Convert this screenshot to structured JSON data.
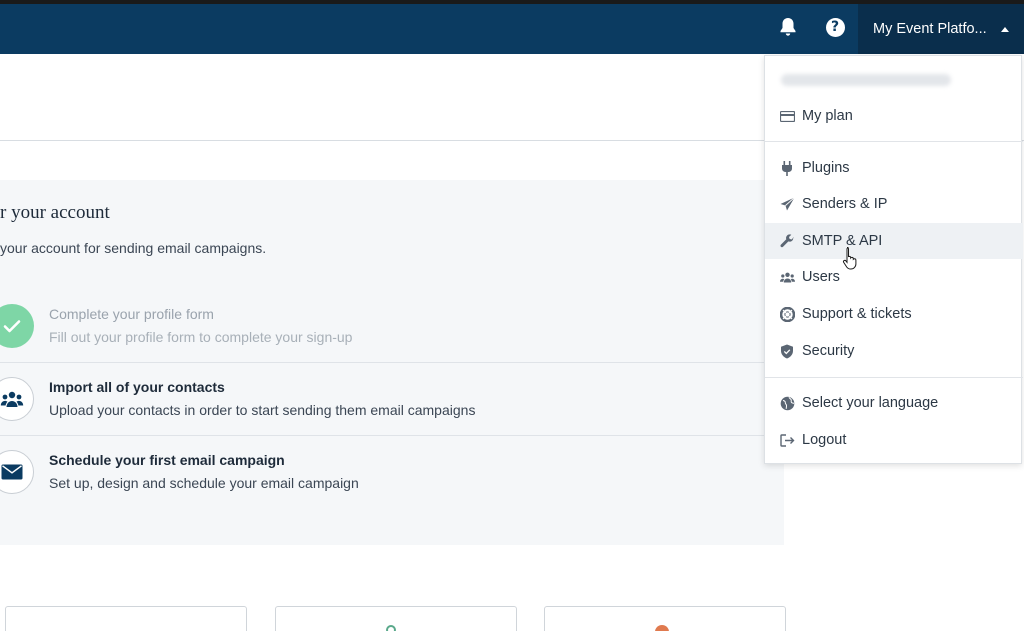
{
  "topbar": {
    "account_label": "My Event Platfo..."
  },
  "panel": {
    "title": "r your account",
    "description": "your account for sending email campaigns."
  },
  "steps": [
    {
      "title": "Complete your profile form",
      "text": "Fill out your profile form to complete your sign-up",
      "status": "done"
    },
    {
      "title": "Import all of your contacts",
      "text": "Upload your contacts in order to start sending them email campaigns",
      "status": "todo"
    },
    {
      "title": "Schedule your first email campaign",
      "text": "Set up, design and schedule your email campaign",
      "status": "todo"
    }
  ],
  "dropdown": {
    "items": [
      {
        "label": "My plan",
        "icon": "credit-card-icon"
      },
      {
        "label": "Plugins",
        "icon": "plug-icon"
      },
      {
        "label": "Senders & IP",
        "icon": "paper-plane-icon"
      },
      {
        "label": "SMTP & API",
        "icon": "wrench-icon"
      },
      {
        "label": "Users",
        "icon": "users-icon"
      },
      {
        "label": "Support & tickets",
        "icon": "lifebuoy-icon"
      },
      {
        "label": "Security",
        "icon": "shield-icon"
      },
      {
        "label": "Select your language",
        "icon": "globe-icon"
      },
      {
        "label": "Logout",
        "icon": "logout-icon"
      }
    ],
    "hovered_item": "SMTP & API"
  },
  "colors": {
    "topbar": "#0b3b61",
    "account_button": "#0a2e4c",
    "done_step": "#7ed6a6",
    "accent_icon": "#0b3b61"
  }
}
